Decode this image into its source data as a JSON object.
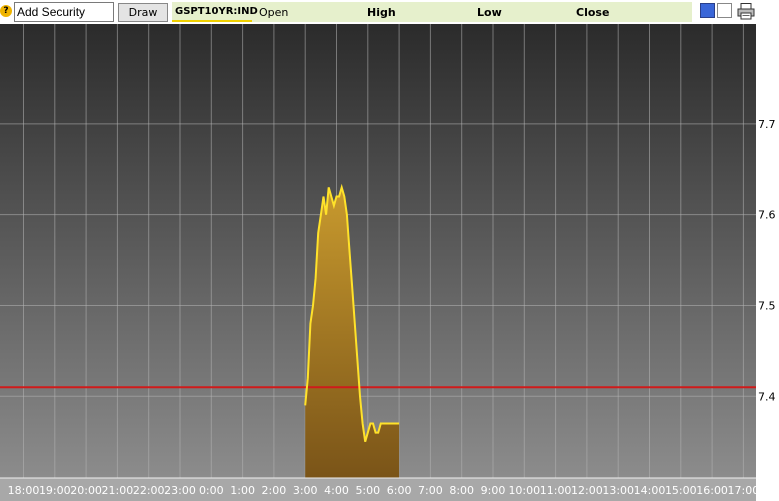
{
  "toolbar": {
    "help_icon": "?",
    "security_input_value": "Add Security",
    "draw_label": "Draw",
    "ticker": "GSPT10YR:IND",
    "open_label": "Open",
    "high_label": "High",
    "low_label": "Low",
    "close_label": "Close",
    "toggle_active_color": "#3a66d8"
  },
  "chart_data": {
    "type": "area",
    "series": [
      {
        "x": [
          "3:00",
          "3:05",
          "3:10",
          "3:15",
          "3:20",
          "3:25",
          "3:30",
          "3:35",
          "3:40",
          "3:45",
          "3:50",
          "3:55",
          "4:00",
          "4:05",
          "4:10",
          "4:15",
          "4:20",
          "4:25",
          "4:30",
          "4:35",
          "4:40",
          "4:45",
          "4:50",
          "4:55",
          "5:00",
          "5:05",
          "5:10",
          "5:15",
          "5:20",
          "5:25",
          "5:30",
          "5:35",
          "5:40",
          "5:45",
          "5:50",
          "5:55",
          "6:00"
        ],
        "values": [
          7.39,
          7.42,
          7.48,
          7.5,
          7.53,
          7.58,
          7.6,
          7.62,
          7.6,
          7.63,
          7.62,
          7.61,
          7.62,
          7.62,
          7.63,
          7.62,
          7.6,
          7.56,
          7.52,
          7.48,
          7.44,
          7.4,
          7.37,
          7.35,
          7.36,
          7.37,
          7.37,
          7.36,
          7.36,
          7.37,
          7.37,
          7.37,
          7.37,
          7.37,
          7.37,
          7.37,
          7.37
        ],
        "line_color": "#ffe22a",
        "fill_top": "#c89a2e",
        "fill_bottom": "#7a5418"
      }
    ],
    "x_ticks": [
      "18:00",
      "19:00",
      "20:00",
      "21:00",
      "22:00",
      "23:00",
      "0:00",
      "1:00",
      "2:00",
      "3:00",
      "4:00",
      "5:00",
      "6:00",
      "7:00",
      "8:00",
      "9:00",
      "10:00",
      "11:00",
      "12:00",
      "13:00",
      "14:00",
      "15:00",
      "16:00",
      "17:00"
    ],
    "y_ticks": [
      7.4,
      7.5,
      7.6,
      7.7
    ],
    "ylim": [
      7.31,
      7.81
    ],
    "reference_line": {
      "value": 7.41,
      "color": "#d01a1a"
    },
    "grid": true,
    "background_top": "#2b2b2b",
    "background_bottom": "#8c8c8c"
  }
}
